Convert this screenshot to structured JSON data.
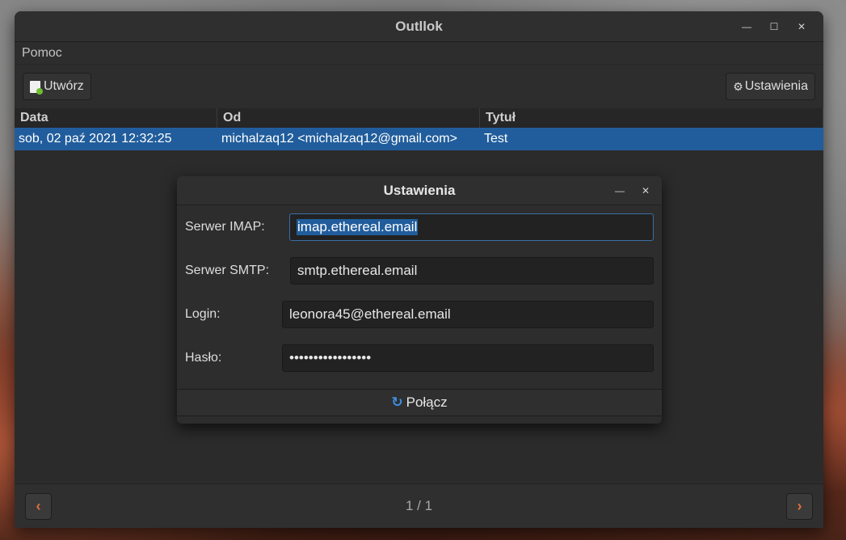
{
  "window": {
    "title": "Outllok"
  },
  "menu": {
    "items": [
      "Pomoc"
    ]
  },
  "toolbar": {
    "new_label": "Utwórz",
    "settings_label": "Ustawienia"
  },
  "table": {
    "columns": [
      "Data",
      "Od",
      "Tytuł"
    ],
    "rows": [
      {
        "date": "sob, 02 paź 2021 12:32:25",
        "from": "michalzaq12 <michalzaq12@gmail.com>",
        "title": "Test"
      }
    ]
  },
  "footer": {
    "page_indicator": "1 / 1"
  },
  "dialog": {
    "title": "Ustawienia",
    "imap_label": "Serwer IMAP:",
    "imap_value": "imap.ethereal.email",
    "smtp_label": "Serwer SMTP:",
    "smtp_value": "smtp.ethereal.email",
    "login_label": "Login:",
    "login_value": "leonora45@ethereal.email",
    "password_label": "Hasło:",
    "password_value": "•••••••••••••••••",
    "connect_label": "Połącz"
  },
  "icons": [
    "new-document-icon",
    "gear-icon",
    "refresh-icon",
    "chevron-left-icon",
    "chevron-right-icon",
    "minimize-icon",
    "maximize-icon",
    "close-icon"
  ],
  "colors": {
    "selection": "#215d9c",
    "accent_nav": "#e0703a",
    "refresh_icon": "#3d8fe0"
  }
}
